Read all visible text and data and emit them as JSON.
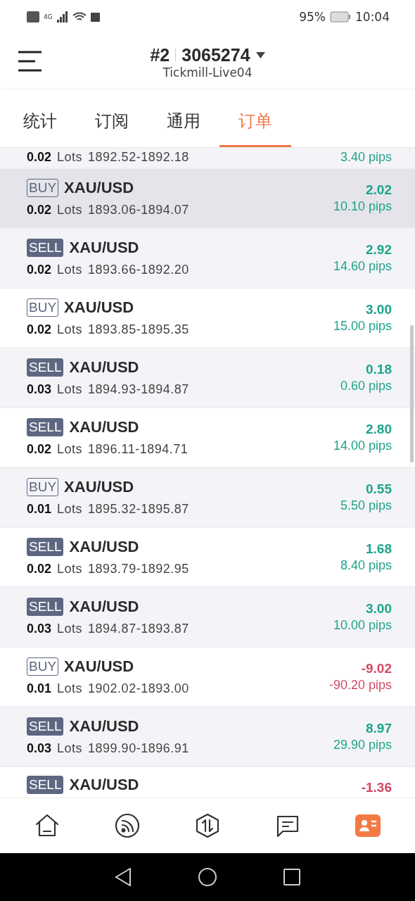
{
  "status_bar": {
    "network": "4G",
    "battery": "95%",
    "time": "10:04"
  },
  "header": {
    "account_no": "#2",
    "account_id": "3065274",
    "server": "Tickmill-Live04"
  },
  "tabs": [
    {
      "label": "统计",
      "selected": false
    },
    {
      "label": "订阅",
      "selected": false
    },
    {
      "label": "通用",
      "selected": false
    },
    {
      "label": "订单",
      "selected": true
    }
  ],
  "orders": [
    {
      "lots": "0.02",
      "lots_label": "Lots",
      "prices": "1892.52-1892.18",
      "pips": "3.40 pips",
      "color": "#1ea48a",
      "selected": false
    },
    {
      "kind": "buy",
      "side": "BUY",
      "symbol": "XAU/USD",
      "lots": "0.02",
      "lots_label": "Lots",
      "prices": "1893.06-1894.07",
      "profit": "2.02",
      "pips": "10.10 pips",
      "color": "#1ea48a",
      "selected": true
    },
    {
      "kind": "sell",
      "side": "SELL",
      "symbol": "XAU/USD",
      "lots": "0.02",
      "lots_label": "Lots",
      "prices": "1893.66-1892.20",
      "profit": "2.92",
      "pips": "14.60 pips",
      "color": "#1ea48a",
      "selected": false
    },
    {
      "kind": "buy",
      "side": "BUY",
      "symbol": "XAU/USD",
      "lots": "0.02",
      "lots_label": "Lots",
      "prices": "1893.85-1895.35",
      "profit": "3.00",
      "pips": "15.00 pips",
      "color": "#1ea48a",
      "selected": false
    },
    {
      "kind": "sell",
      "side": "SELL",
      "symbol": "XAU/USD",
      "lots": "0.03",
      "lots_label": "Lots",
      "prices": "1894.93-1894.87",
      "profit": "0.18",
      "pips": "0.60 pips",
      "color": "#1ea48a",
      "selected": false
    },
    {
      "kind": "sell",
      "side": "SELL",
      "symbol": "XAU/USD",
      "lots": "0.02",
      "lots_label": "Lots",
      "prices": "1896.11-1894.71",
      "profit": "2.80",
      "pips": "14.00 pips",
      "color": "#1ea48a",
      "selected": false
    },
    {
      "kind": "buy",
      "side": "BUY",
      "symbol": "XAU/USD",
      "lots": "0.01",
      "lots_label": "Lots",
      "prices": "1895.32-1895.87",
      "profit": "0.55",
      "pips": "5.50 pips",
      "color": "#1ea48a",
      "selected": false
    },
    {
      "kind": "sell",
      "side": "SELL",
      "symbol": "XAU/USD",
      "lots": "0.02",
      "lots_label": "Lots",
      "prices": "1893.79-1892.95",
      "profit": "1.68",
      "pips": "8.40 pips",
      "color": "#1ea48a",
      "selected": false
    },
    {
      "kind": "sell",
      "side": "SELL",
      "symbol": "XAU/USD",
      "lots": "0.03",
      "lots_label": "Lots",
      "prices": "1894.87-1893.87",
      "profit": "3.00",
      "pips": "10.00 pips",
      "color": "#1ea48a",
      "selected": false
    },
    {
      "kind": "buy",
      "side": "BUY",
      "symbol": "XAU/USD",
      "lots": "0.01",
      "lots_label": "Lots",
      "prices": "1902.02-1893.00",
      "profit": "-9.02",
      "pips": "-90.20 pips",
      "color": "#d24a62",
      "selected": false
    },
    {
      "kind": "sell",
      "side": "SELL",
      "symbol": "XAU/USD",
      "lots": "0.03",
      "lots_label": "Lots",
      "prices": "1899.90-1896.91",
      "profit": "8.97",
      "pips": "29.90 pips",
      "color": "#1ea48a",
      "selected": false
    },
    {
      "kind": "sell",
      "side": "SELL",
      "symbol": "XAU/USD",
      "profit": "-1.36",
      "color": "#d24a62",
      "selected": false
    }
  ],
  "bottom_nav": [
    {
      "kind": "home",
      "selected": false
    },
    {
      "kind": "feed",
      "selected": false
    },
    {
      "kind": "trade",
      "selected": false
    },
    {
      "kind": "chat",
      "selected": false
    },
    {
      "kind": "profile",
      "selected": true
    }
  ]
}
